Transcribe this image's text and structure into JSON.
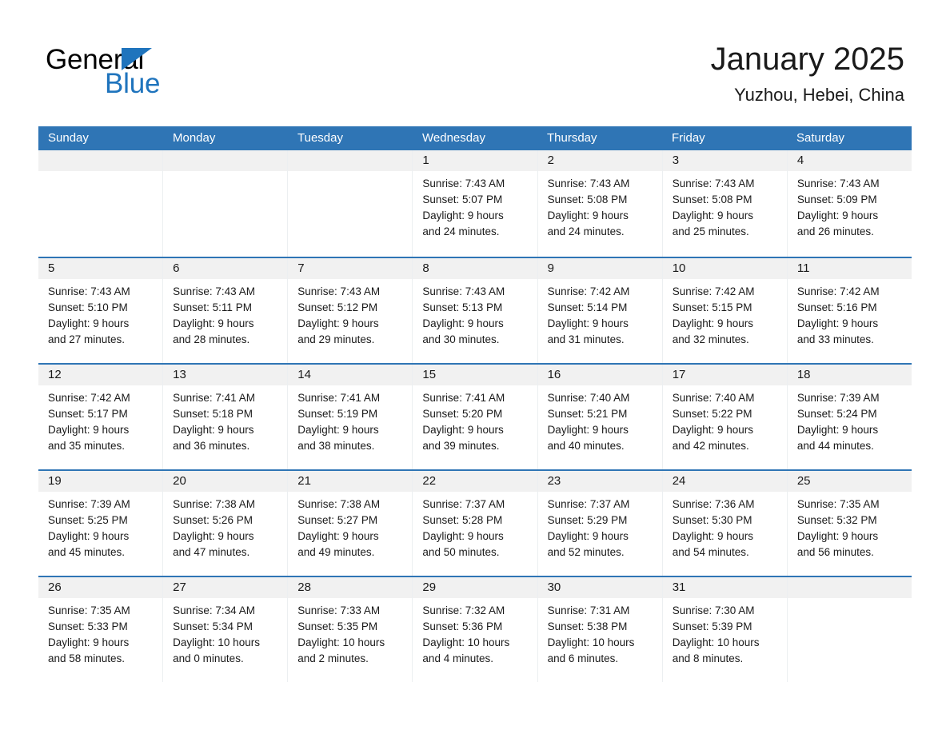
{
  "logo": {
    "word_one": "General",
    "word_two": "Blue",
    "triangle_icon": "triangle-icon",
    "brand_color": "#1f74bd"
  },
  "header": {
    "title": "January 2025",
    "subtitle": "Yuzhou, Hebei, China"
  },
  "theme": {
    "header_blue": "#2f75b5",
    "day_band_gray": "#f1f1f1",
    "text": "#1a1a1a"
  },
  "calendar": {
    "day_headers": [
      "Sunday",
      "Monday",
      "Tuesday",
      "Wednesday",
      "Thursday",
      "Friday",
      "Saturday"
    ],
    "weeks": [
      [
        {
          "day": "",
          "lines": []
        },
        {
          "day": "",
          "lines": []
        },
        {
          "day": "",
          "lines": []
        },
        {
          "day": "1",
          "lines": [
            "Sunrise: 7:43 AM",
            "Sunset: 5:07 PM",
            "Daylight: 9 hours",
            "and 24 minutes."
          ]
        },
        {
          "day": "2",
          "lines": [
            "Sunrise: 7:43 AM",
            "Sunset: 5:08 PM",
            "Daylight: 9 hours",
            "and 24 minutes."
          ]
        },
        {
          "day": "3",
          "lines": [
            "Sunrise: 7:43 AM",
            "Sunset: 5:08 PM",
            "Daylight: 9 hours",
            "and 25 minutes."
          ]
        },
        {
          "day": "4",
          "lines": [
            "Sunrise: 7:43 AM",
            "Sunset: 5:09 PM",
            "Daylight: 9 hours",
            "and 26 minutes."
          ]
        }
      ],
      [
        {
          "day": "5",
          "lines": [
            "Sunrise: 7:43 AM",
            "Sunset: 5:10 PM",
            "Daylight: 9 hours",
            "and 27 minutes."
          ]
        },
        {
          "day": "6",
          "lines": [
            "Sunrise: 7:43 AM",
            "Sunset: 5:11 PM",
            "Daylight: 9 hours",
            "and 28 minutes."
          ]
        },
        {
          "day": "7",
          "lines": [
            "Sunrise: 7:43 AM",
            "Sunset: 5:12 PM",
            "Daylight: 9 hours",
            "and 29 minutes."
          ]
        },
        {
          "day": "8",
          "lines": [
            "Sunrise: 7:43 AM",
            "Sunset: 5:13 PM",
            "Daylight: 9 hours",
            "and 30 minutes."
          ]
        },
        {
          "day": "9",
          "lines": [
            "Sunrise: 7:42 AM",
            "Sunset: 5:14 PM",
            "Daylight: 9 hours",
            "and 31 minutes."
          ]
        },
        {
          "day": "10",
          "lines": [
            "Sunrise: 7:42 AM",
            "Sunset: 5:15 PM",
            "Daylight: 9 hours",
            "and 32 minutes."
          ]
        },
        {
          "day": "11",
          "lines": [
            "Sunrise: 7:42 AM",
            "Sunset: 5:16 PM",
            "Daylight: 9 hours",
            "and 33 minutes."
          ]
        }
      ],
      [
        {
          "day": "12",
          "lines": [
            "Sunrise: 7:42 AM",
            "Sunset: 5:17 PM",
            "Daylight: 9 hours",
            "and 35 minutes."
          ]
        },
        {
          "day": "13",
          "lines": [
            "Sunrise: 7:41 AM",
            "Sunset: 5:18 PM",
            "Daylight: 9 hours",
            "and 36 minutes."
          ]
        },
        {
          "day": "14",
          "lines": [
            "Sunrise: 7:41 AM",
            "Sunset: 5:19 PM",
            "Daylight: 9 hours",
            "and 38 minutes."
          ]
        },
        {
          "day": "15",
          "lines": [
            "Sunrise: 7:41 AM",
            "Sunset: 5:20 PM",
            "Daylight: 9 hours",
            "and 39 minutes."
          ]
        },
        {
          "day": "16",
          "lines": [
            "Sunrise: 7:40 AM",
            "Sunset: 5:21 PM",
            "Daylight: 9 hours",
            "and 40 minutes."
          ]
        },
        {
          "day": "17",
          "lines": [
            "Sunrise: 7:40 AM",
            "Sunset: 5:22 PM",
            "Daylight: 9 hours",
            "and 42 minutes."
          ]
        },
        {
          "day": "18",
          "lines": [
            "Sunrise: 7:39 AM",
            "Sunset: 5:24 PM",
            "Daylight: 9 hours",
            "and 44 minutes."
          ]
        }
      ],
      [
        {
          "day": "19",
          "lines": [
            "Sunrise: 7:39 AM",
            "Sunset: 5:25 PM",
            "Daylight: 9 hours",
            "and 45 minutes."
          ]
        },
        {
          "day": "20",
          "lines": [
            "Sunrise: 7:38 AM",
            "Sunset: 5:26 PM",
            "Daylight: 9 hours",
            "and 47 minutes."
          ]
        },
        {
          "day": "21",
          "lines": [
            "Sunrise: 7:38 AM",
            "Sunset: 5:27 PM",
            "Daylight: 9 hours",
            "and 49 minutes."
          ]
        },
        {
          "day": "22",
          "lines": [
            "Sunrise: 7:37 AM",
            "Sunset: 5:28 PM",
            "Daylight: 9 hours",
            "and 50 minutes."
          ]
        },
        {
          "day": "23",
          "lines": [
            "Sunrise: 7:37 AM",
            "Sunset: 5:29 PM",
            "Daylight: 9 hours",
            "and 52 minutes."
          ]
        },
        {
          "day": "24",
          "lines": [
            "Sunrise: 7:36 AM",
            "Sunset: 5:30 PM",
            "Daylight: 9 hours",
            "and 54 minutes."
          ]
        },
        {
          "day": "25",
          "lines": [
            "Sunrise: 7:35 AM",
            "Sunset: 5:32 PM",
            "Daylight: 9 hours",
            "and 56 minutes."
          ]
        }
      ],
      [
        {
          "day": "26",
          "lines": [
            "Sunrise: 7:35 AM",
            "Sunset: 5:33 PM",
            "Daylight: 9 hours",
            "and 58 minutes."
          ]
        },
        {
          "day": "27",
          "lines": [
            "Sunrise: 7:34 AM",
            "Sunset: 5:34 PM",
            "Daylight: 10 hours",
            "and 0 minutes."
          ]
        },
        {
          "day": "28",
          "lines": [
            "Sunrise: 7:33 AM",
            "Sunset: 5:35 PM",
            "Daylight: 10 hours",
            "and 2 minutes."
          ]
        },
        {
          "day": "29",
          "lines": [
            "Sunrise: 7:32 AM",
            "Sunset: 5:36 PM",
            "Daylight: 10 hours",
            "and 4 minutes."
          ]
        },
        {
          "day": "30",
          "lines": [
            "Sunrise: 7:31 AM",
            "Sunset: 5:38 PM",
            "Daylight: 10 hours",
            "and 6 minutes."
          ]
        },
        {
          "day": "31",
          "lines": [
            "Sunrise: 7:30 AM",
            "Sunset: 5:39 PM",
            "Daylight: 10 hours",
            "and 8 minutes."
          ]
        },
        {
          "day": "",
          "lines": []
        }
      ]
    ]
  }
}
